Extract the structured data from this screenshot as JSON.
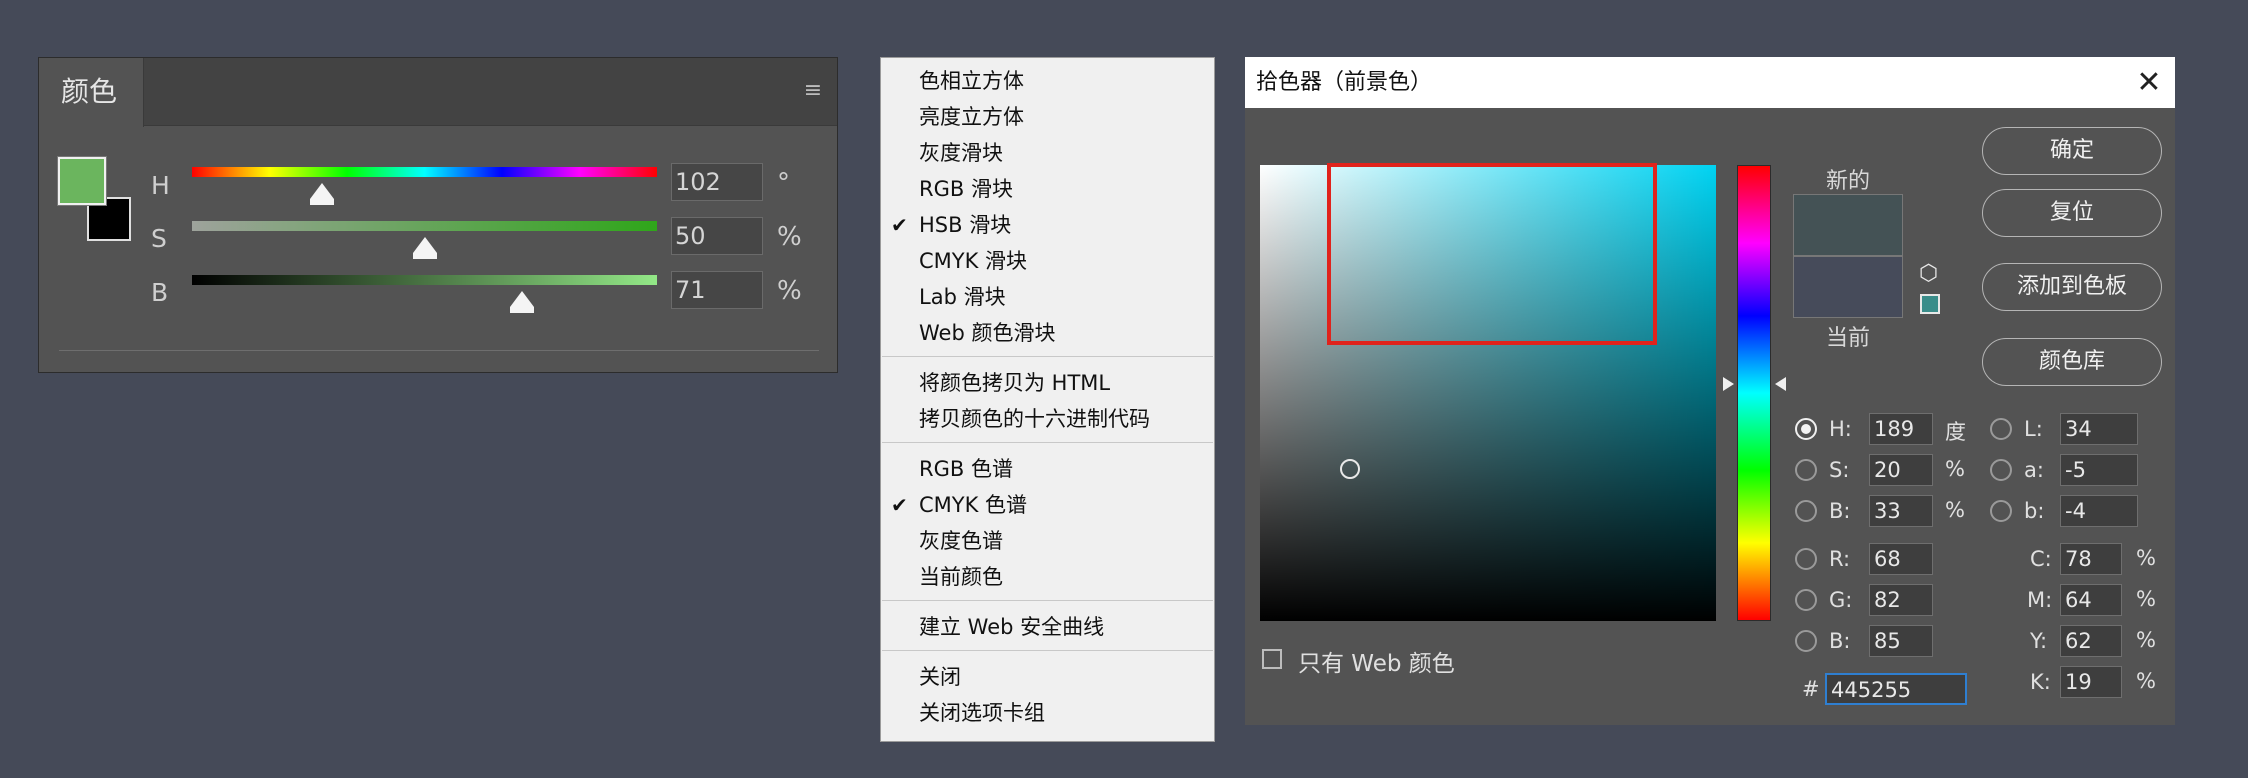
{
  "color_panel": {
    "tab_title": "颜色",
    "menu_icon": "hamburger-menu-icon",
    "foreground_color": "#6bb55e",
    "background_color": "#000000",
    "sliders": [
      {
        "label": "H",
        "value": "102",
        "unit": "°",
        "fraction": 0.28
      },
      {
        "label": "S",
        "value": "50",
        "unit": "%",
        "fraction": 0.5
      },
      {
        "label": "B",
        "value": "71",
        "unit": "%",
        "fraction": 0.71
      }
    ]
  },
  "context_menu": {
    "groups": [
      [
        {
          "label": "色相立方体",
          "checked": false
        },
        {
          "label": "亮度立方体",
          "checked": false
        },
        {
          "label": "灰度滑块",
          "checked": false
        },
        {
          "label": "RGB 滑块",
          "checked": false
        },
        {
          "label": "HSB 滑块",
          "checked": true
        },
        {
          "label": "CMYK 滑块",
          "checked": false
        },
        {
          "label": "Lab 滑块",
          "checked": false
        },
        {
          "label": "Web 颜色滑块",
          "checked": false
        }
      ],
      [
        {
          "label": "将颜色拷贝为 HTML",
          "checked": false
        },
        {
          "label": "拷贝颜色的十六进制代码",
          "checked": false
        }
      ],
      [
        {
          "label": "RGB 色谱",
          "checked": false
        },
        {
          "label": "CMYK 色谱",
          "checked": true
        },
        {
          "label": "灰度色谱",
          "checked": false
        },
        {
          "label": "当前颜色",
          "checked": false
        }
      ],
      [
        {
          "label": "建立 Web 安全曲线",
          "checked": false
        }
      ],
      [
        {
          "label": "关闭",
          "checked": false
        },
        {
          "label": "关闭选项卡组",
          "checked": false
        }
      ]
    ],
    "check_glyph": "✔"
  },
  "picker": {
    "title": "拾色器（前景色）",
    "close_glyph": "✕",
    "web_only_label": "只有 Web 颜色",
    "new_label": "新的",
    "current_label": "当前",
    "new_color": "#445255",
    "current_color": "#464b5a",
    "buttons": {
      "ok": "确定",
      "reset": "复位",
      "add_to_swatches": "添加到色板",
      "color_libraries": "颜色库"
    },
    "hsb": [
      {
        "label": "H:",
        "value": "189",
        "unit": "度",
        "selected": true
      },
      {
        "label": "S:",
        "value": "20",
        "unit": "%",
        "selected": false
      },
      {
        "label": "B:",
        "value": "33",
        "unit": "%",
        "selected": false
      }
    ],
    "rgb": [
      {
        "label": "R:",
        "value": "68"
      },
      {
        "label": "G:",
        "value": "82"
      },
      {
        "label": "B:",
        "value": "85"
      }
    ],
    "lab": [
      {
        "label": "L:",
        "value": "34"
      },
      {
        "label": "a:",
        "value": "-5"
      },
      {
        "label": "b:",
        "value": "-4"
      }
    ],
    "cmyk": [
      {
        "label": "C:",
        "value": "78",
        "unit": "%"
      },
      {
        "label": "M:",
        "value": "64",
        "unit": "%"
      },
      {
        "label": "Y:",
        "value": "62",
        "unit": "%"
      },
      {
        "label": "K:",
        "value": "19",
        "unit": "%"
      }
    ],
    "hex_label": "#",
    "hex_value": "445255",
    "hue_selected": 189
  }
}
